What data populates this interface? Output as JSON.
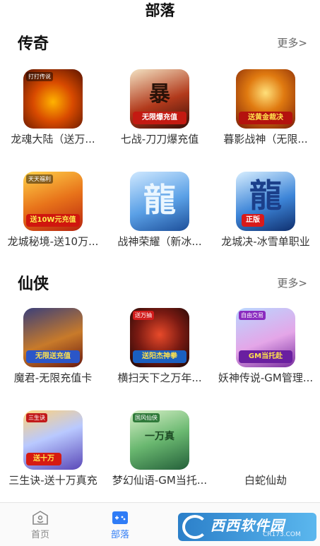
{
  "page": {
    "title": "部落"
  },
  "sections": [
    {
      "title": "传奇",
      "more": "更多>",
      "games": [
        {
          "name": "龙魂大陆（送万...",
          "tag": "打打传说"
        },
        {
          "name": "七战-刀刀爆充值",
          "caption": "无限爆充值"
        },
        {
          "name": "暮影战神（无限...",
          "caption": "送黄金裁决"
        },
        {
          "name": "龙城秘境-送10万...",
          "caption": "送10W元充值",
          "tag": "天天福利"
        },
        {
          "name": "战神荣耀（新冰...",
          "glyph": "龍"
        },
        {
          "name": "龙城决-冰雪单职业",
          "glyph": "龍",
          "caption": "正版"
        }
      ]
    },
    {
      "title": "仙侠",
      "more": "更多>",
      "games": [
        {
          "name": "魔君-无限充值卡",
          "caption": "无限送充值"
        },
        {
          "name": "横扫天下之万年...",
          "caption": "送阳杰神拳",
          "tag": "送万抽"
        },
        {
          "name": "妖神传说-GM管理...",
          "caption": "GM当托赴",
          "tag": "自由交易"
        },
        {
          "name": "三生诀-送十万真充",
          "caption": "送十万",
          "tag": "三生诀"
        },
        {
          "name": "梦幻仙语-GM当托...",
          "caption": "一万真",
          "tag": "国风仙侠"
        },
        {
          "name": "白蛇仙劫"
        }
      ]
    }
  ],
  "tabbar": {
    "items": [
      {
        "label": "首页",
        "active": false
      },
      {
        "label": "部落",
        "active": true
      }
    ]
  },
  "watermark": {
    "text": "西西软件园",
    "sub": "CR173.COM"
  },
  "colors": {
    "active": "#2f7cf6",
    "inactive": "#888888"
  }
}
